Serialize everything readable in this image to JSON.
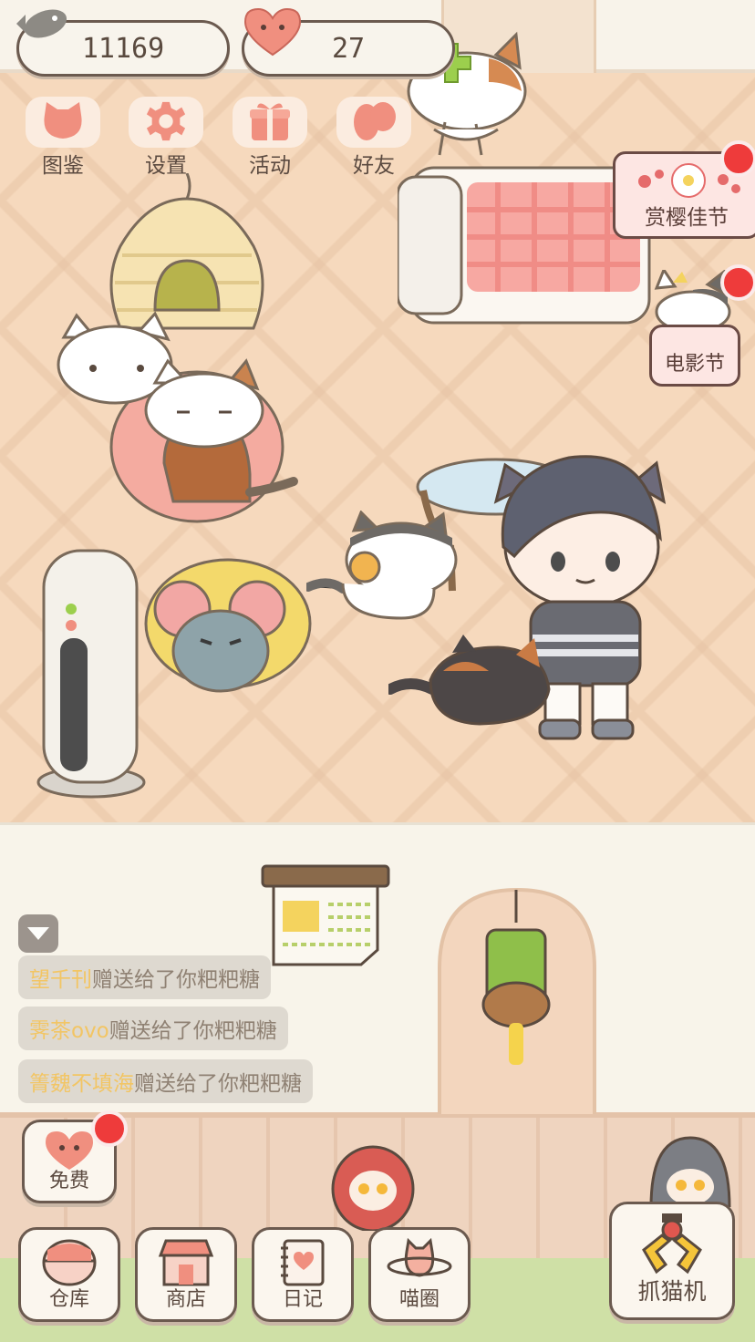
{
  "hud": {
    "fish_count": "11169",
    "heart_count": "27"
  },
  "top_menu": [
    {
      "label": "图鉴",
      "icon": "cat-head-icon"
    },
    {
      "label": "设置",
      "icon": "gear-icon"
    },
    {
      "label": "活动",
      "icon": "gift-icon"
    },
    {
      "label": "好友",
      "icon": "friends-icon"
    }
  ],
  "events": {
    "sakura": "赏樱佳节",
    "movie": "电影节"
  },
  "chat": [
    {
      "user": "望千刊",
      "message": "赠送给了你粑粑糖"
    },
    {
      "user": "霁茶ovo",
      "message": "赠送给了你粑粑糖"
    },
    {
      "user": "箐魏不填海",
      "message": "赠送给了你粑粑糖"
    }
  ],
  "buttons": {
    "free": "免费",
    "claw_machine": "抓猫机"
  },
  "bottom_tabs": [
    {
      "label": "仓库",
      "icon": "storage-icon"
    },
    {
      "label": "商店",
      "icon": "shop-icon"
    },
    {
      "label": "日记",
      "icon": "diary-icon"
    },
    {
      "label": "喵圈",
      "icon": "planet-cat-icon"
    }
  ],
  "colors": {
    "floor": "#f6d9bd",
    "wall": "#f8f4ea",
    "outline": "#6b5a4f",
    "accent_pink": "#f08f7f",
    "notification_red": "#ee3b3b",
    "username_yellow": "#f2c564"
  }
}
